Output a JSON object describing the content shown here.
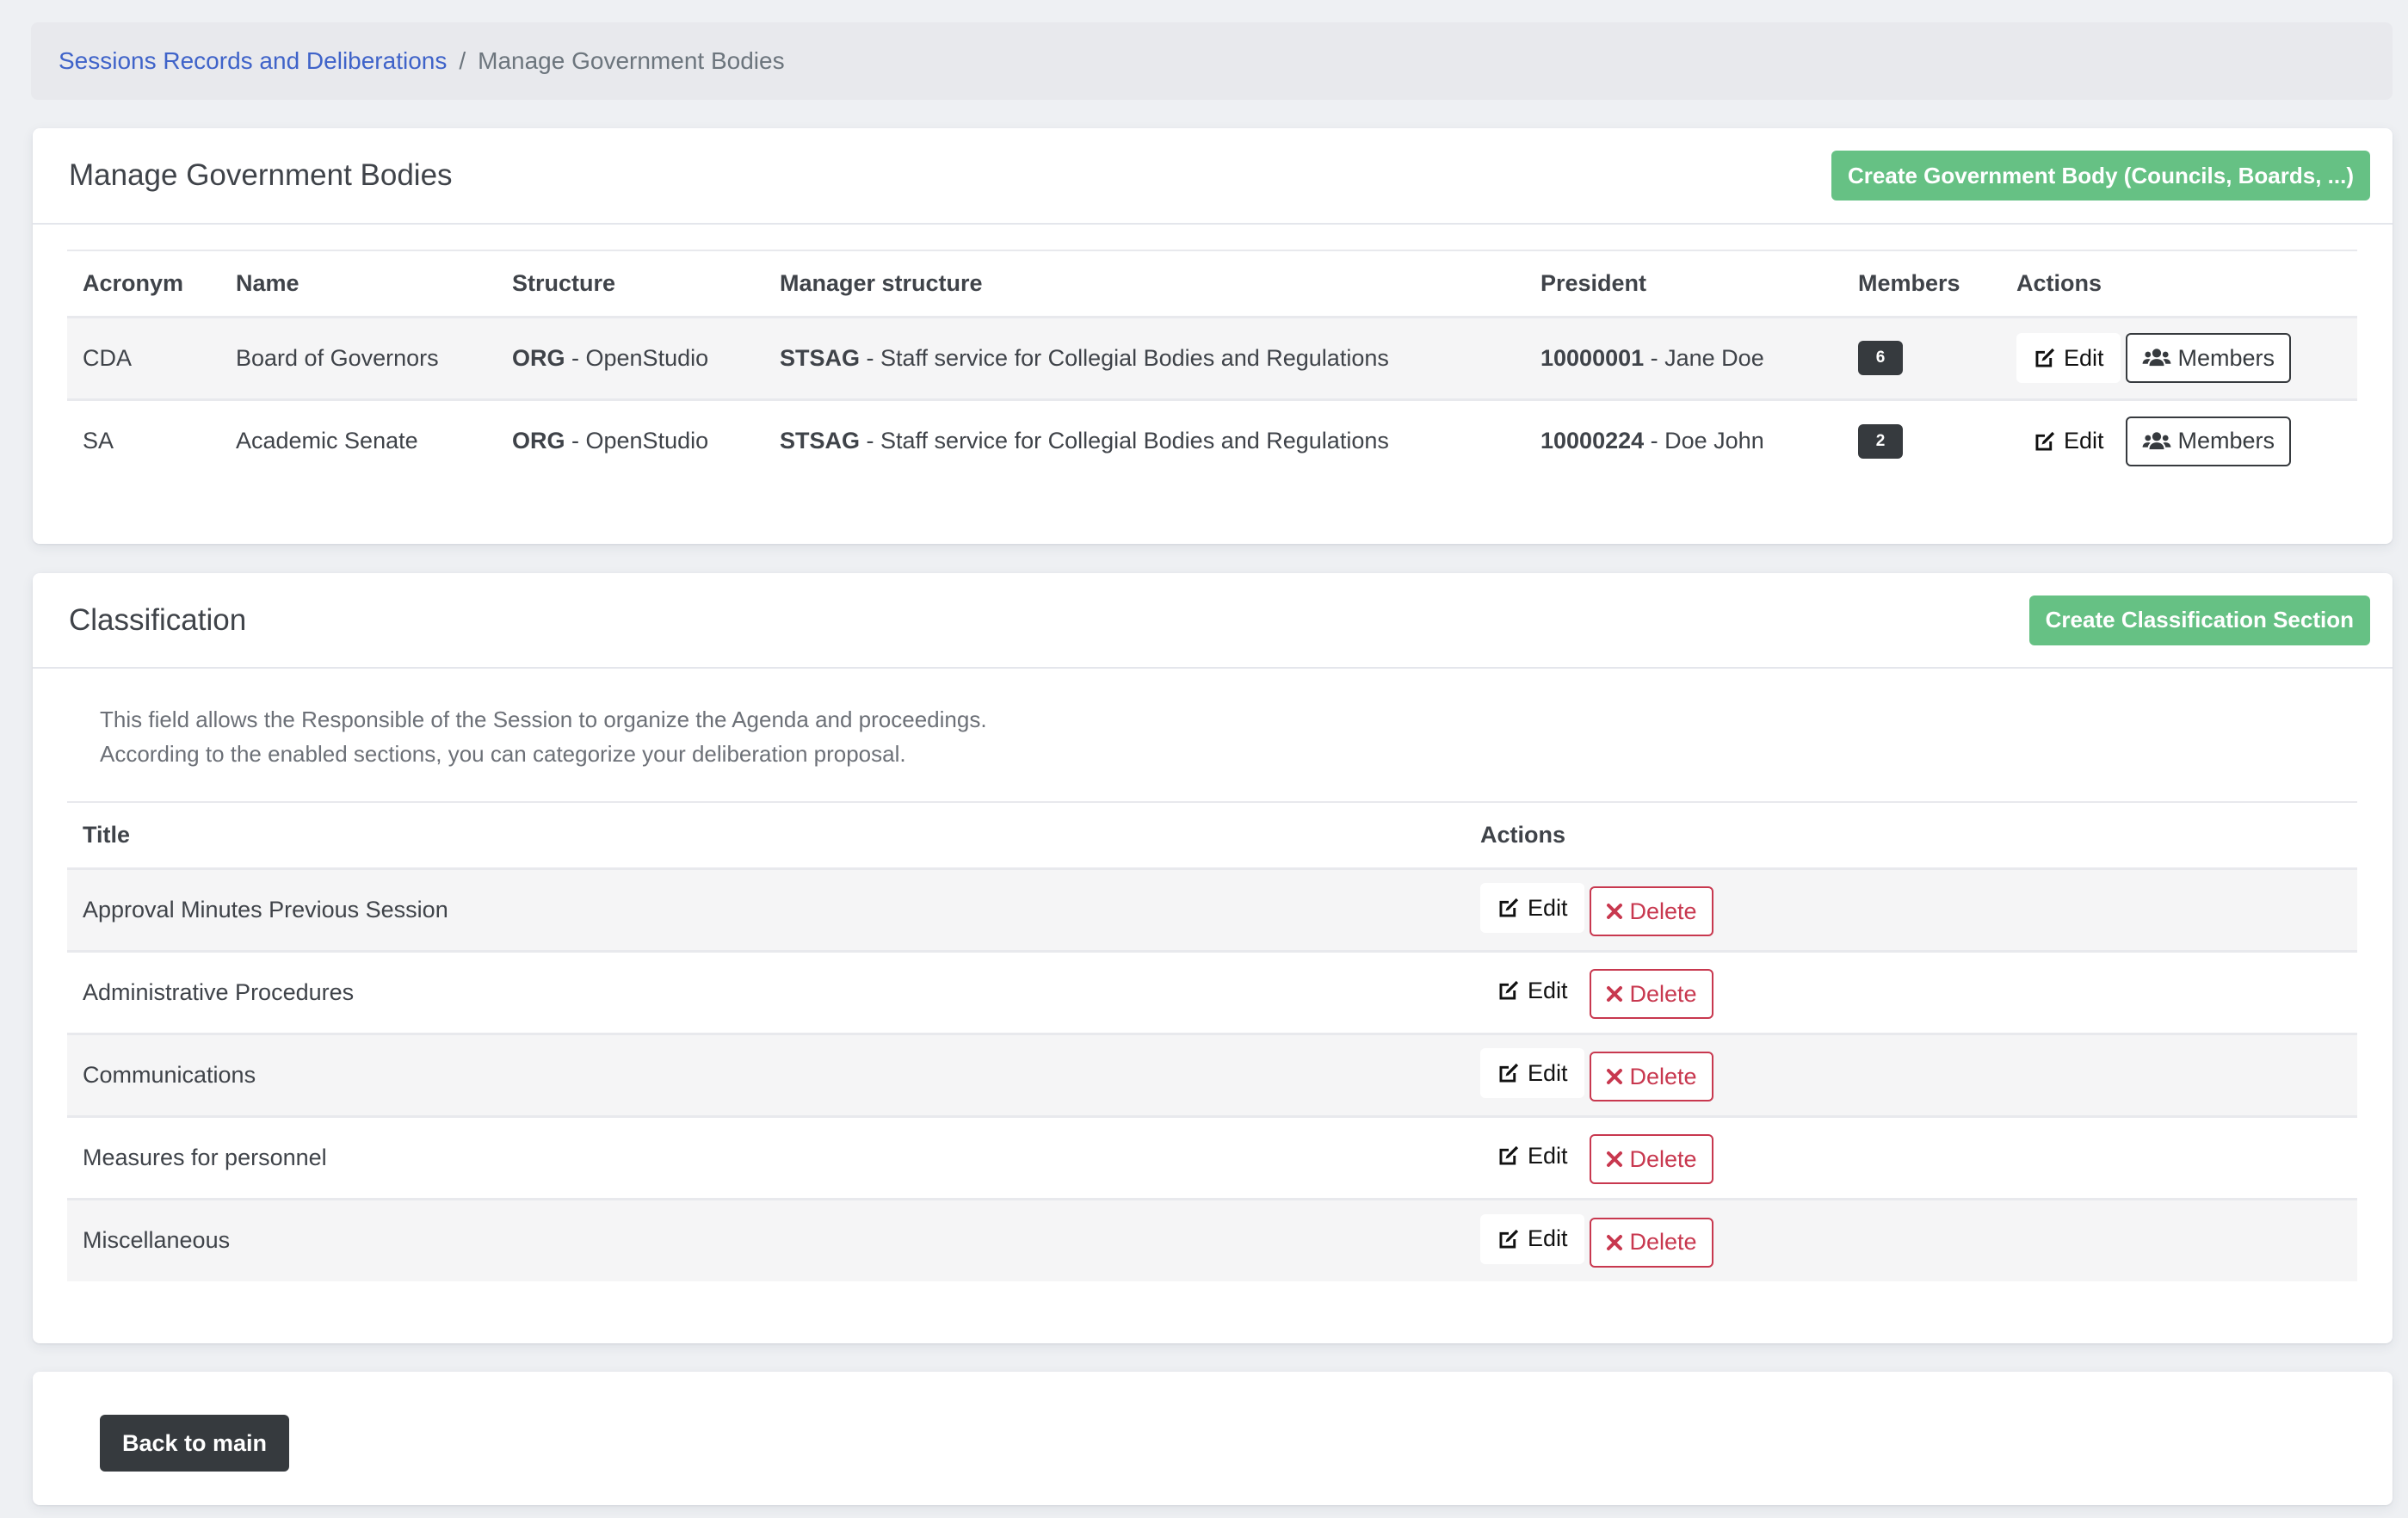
{
  "breadcrumb": {
    "items": [
      {
        "label": "Sessions Records and Deliberations",
        "link": true
      },
      {
        "label": "Manage Government Bodies",
        "link": false
      }
    ],
    "separator": "/"
  },
  "bodies_card": {
    "title": "Manage Government Bodies",
    "create_button": "Create Government Body (Councils, Boards, ...)",
    "columns": [
      "Acronym",
      "Name",
      "Structure",
      "Manager structure",
      "President",
      "Members",
      "Actions"
    ],
    "rows": [
      {
        "acronym": "CDA",
        "name": "Board of Governors",
        "structure_code": "ORG",
        "structure_name": " - OpenStudio",
        "manager_code": "STSAG",
        "manager_name": " - Staff service for Collegial Bodies and Regulations",
        "president_id": "10000001",
        "president_name": " - Jane Doe",
        "members_count": "6",
        "edit_label": "Edit",
        "members_label": "Members"
      },
      {
        "acronym": "SA",
        "name": "Academic Senate",
        "structure_code": "ORG",
        "structure_name": " - OpenStudio",
        "manager_code": "STSAG",
        "manager_name": " - Staff service for Collegial Bodies and Regulations",
        "president_id": "10000224",
        "president_name": " - Doe John",
        "members_count": "2",
        "edit_label": "Edit",
        "members_label": "Members"
      }
    ]
  },
  "classification_card": {
    "title": "Classification",
    "create_button": "Create Classification Section",
    "description": [
      "This field allows the Responsible of the Session to organize the Agenda and proceedings.",
      "According to the enabled sections, you can categorize your deliberation proposal."
    ],
    "columns": [
      "Title",
      "Actions"
    ],
    "rows": [
      {
        "title": "Approval Minutes Previous Session",
        "edit_label": "Edit",
        "delete_label": "Delete"
      },
      {
        "title": "Administrative Procedures",
        "edit_label": "Edit",
        "delete_label": "Delete"
      },
      {
        "title": "Communications",
        "edit_label": "Edit",
        "delete_label": "Delete"
      },
      {
        "title": "Measures for personnel",
        "edit_label": "Edit",
        "delete_label": "Delete"
      },
      {
        "title": "Miscellaneous",
        "edit_label": "Edit",
        "delete_label": "Delete"
      }
    ]
  },
  "footer_card": {
    "back_button": "Back to main"
  },
  "icons": {
    "edit": "edit-square-pencil-icon",
    "members": "users-group-icon",
    "delete": "x-mark-icon"
  },
  "colors": {
    "primary_link": "#3f63c9",
    "success": "#66c184",
    "danger": "#c8384f",
    "dark": "#363a3e"
  }
}
